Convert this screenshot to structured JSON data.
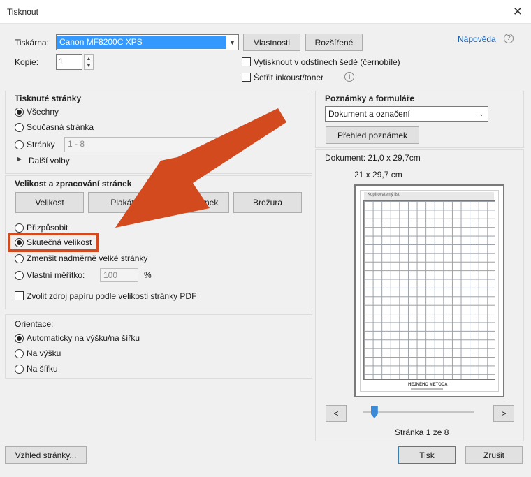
{
  "window": {
    "title": "Tisknout",
    "close_icon": "close-icon"
  },
  "printer": {
    "label": "Tiskárna:",
    "selected": "Canon MF8200C XPS",
    "properties_button": "Vlastnosti",
    "advanced_button": "Rozšířené",
    "help_link": "Nápověda",
    "help_icon": "?"
  },
  "copies": {
    "label": "Kopie:",
    "value": "1"
  },
  "options": {
    "grayscale": "Vytisknout v odstínech šedé (černobíle)",
    "save_ink": "Šetřit inkoust/toner",
    "info_icon": "i"
  },
  "pages_section": {
    "title": "Tisknuté stránky",
    "all": "Všechny",
    "current": "Současná stránka",
    "pages": "Stránky",
    "pages_value": "1 - 8",
    "more_options": "Další volby",
    "more_icon": "▶"
  },
  "sizing_section": {
    "title": "Velikost a zpracování stránek",
    "tabs": [
      "Velikost",
      "Plakát",
      "Více stránek",
      "Brožura"
    ],
    "fit": "Přizpůsobit",
    "actual_size": "Skutečná velikost",
    "shrink": "Zmenšit nadměrně velké stránky",
    "custom_scale": "Vlastní měřítko:",
    "custom_scale_value": "100",
    "percent": "%",
    "paper_source": "Zvolit zdroj papíru podle velikosti stránky PDF"
  },
  "orientation_section": {
    "title": "Orientace:",
    "auto": "Automaticky na výšku/na šířku",
    "portrait": "Na výšku",
    "landscape": "Na šířku"
  },
  "comments_section": {
    "title": "Poznámky a formuláře",
    "selected": "Dokument a označení",
    "summary_button": "Přehled poznámek"
  },
  "preview": {
    "doc_size": "Dokument: 21,0 x 29,7cm",
    "page_size": "21 x 29,7 cm",
    "sheet_title": "Kopírovatelný list",
    "footer_title": "HEJNÉHO METODA",
    "prev": "<",
    "next": ">",
    "page_indicator": "Stránka 1 ze 8",
    "slider_position": 0.1
  },
  "footer": {
    "page_setup": "Vzhled stránky...",
    "print": "Tisk",
    "cancel": "Zrušit"
  },
  "annotation": {
    "arrow_color": "#d24a1e",
    "highlight_color": "#d24a1e"
  }
}
